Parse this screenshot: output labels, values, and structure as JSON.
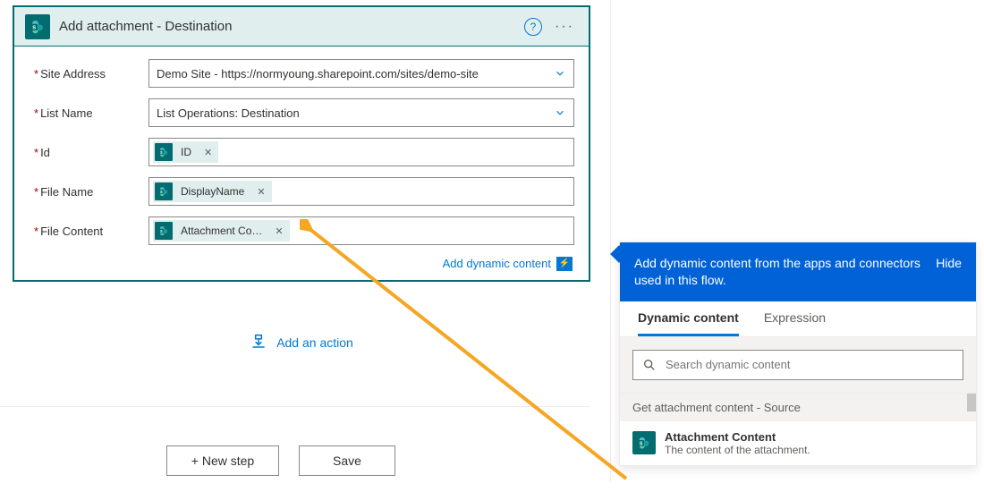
{
  "action": {
    "title": "Add attachment - Destination",
    "fields": [
      {
        "label": "Site Address",
        "type": "dropdown",
        "value": "Demo Site - https://normyoung.sharepoint.com/sites/demo-site"
      },
      {
        "label": "List Name",
        "type": "dropdown",
        "value": "List Operations: Destination"
      },
      {
        "label": "Id",
        "type": "token",
        "token": "ID"
      },
      {
        "label": "File Name",
        "type": "token",
        "token": "DisplayName"
      },
      {
        "label": "File Content",
        "type": "token",
        "token": "Attachment Co…"
      }
    ],
    "dyn_hint": "Add dynamic content"
  },
  "add_action_label": "Add an action",
  "buttons": {
    "new_step": "+ New step",
    "save": "Save"
  },
  "dc_panel": {
    "header_text": "Add dynamic content from the apps and connectors used in this flow.",
    "hide_label": "Hide",
    "tabs": {
      "dynamic": "Dynamic content",
      "expression": "Expression"
    },
    "search_placeholder": "Search dynamic content",
    "group_label": "Get attachment content - Source",
    "item": {
      "title": "Attachment Content",
      "desc": "The content of the attachment."
    }
  }
}
